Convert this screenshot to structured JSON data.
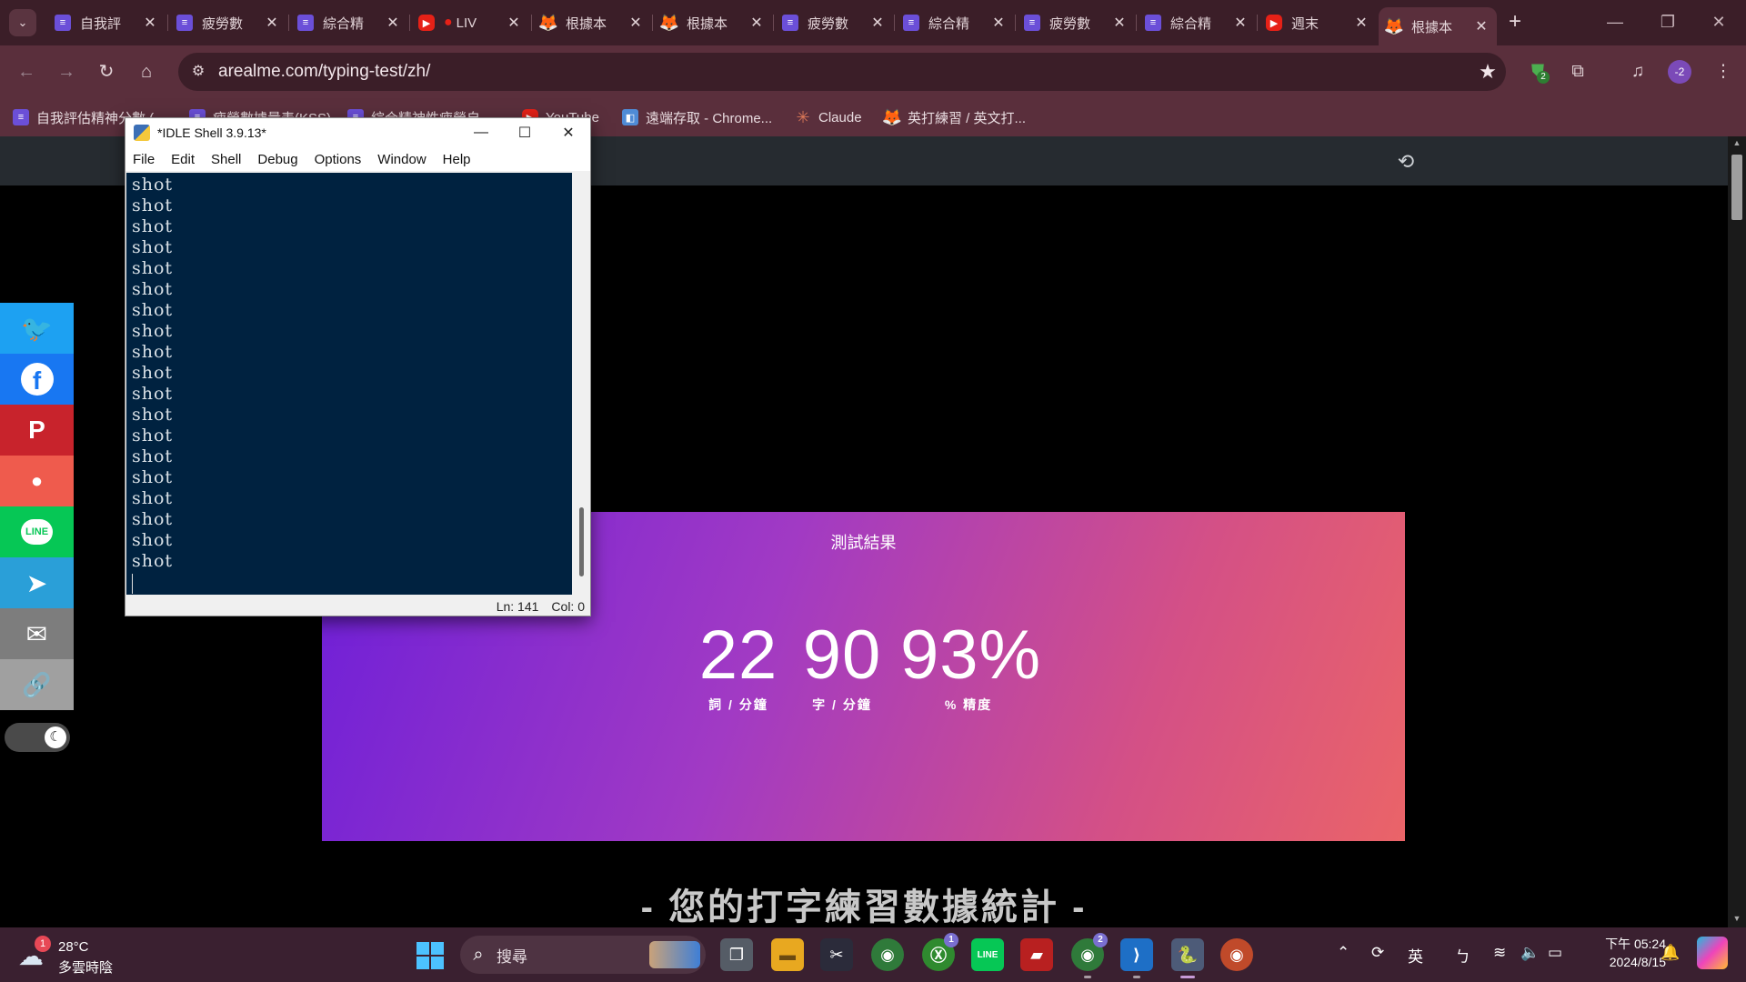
{
  "browser": {
    "tabs": [
      {
        "title": "自我評",
        "icon": "list-icon",
        "color": "#6b4fd8"
      },
      {
        "title": "疲勞數",
        "icon": "list-icon",
        "color": "#6b4fd8"
      },
      {
        "title": "綜合精",
        "icon": "list-icon",
        "color": "#6b4fd8"
      },
      {
        "title": "LIV",
        "icon": "youtube-icon",
        "color": "#e62117"
      },
      {
        "title": "根據本",
        "icon": "fox-icon",
        "color": "#f08a24"
      },
      {
        "title": "根據本",
        "icon": "fox-icon",
        "color": "#f08a24"
      },
      {
        "title": "疲勞數",
        "icon": "list-icon",
        "color": "#6b4fd8"
      },
      {
        "title": "綜合精",
        "icon": "list-icon",
        "color": "#6b4fd8"
      },
      {
        "title": "疲勞數",
        "icon": "list-icon",
        "color": "#6b4fd8"
      },
      {
        "title": "綜合精",
        "icon": "list-icon",
        "color": "#6b4fd8"
      },
      {
        "title": "週末",
        "icon": "youtube-icon",
        "color": "#e62117"
      },
      {
        "title": "根據本",
        "icon": "fox-icon",
        "color": "#f08a24"
      }
    ],
    "active_tab_index": 11,
    "url": "arealme.com/typing-test/zh/",
    "profile_badge": "-2",
    "extension_badge": "2",
    "bookmarks": [
      {
        "label": "自我評估精神分數 (",
        "icon": "list-icon"
      },
      {
        "label": "疲勞數據量表(KSS)",
        "icon": "list-icon"
      },
      {
        "label": "綜合精神性疲勞自...",
        "icon": "list-icon"
      },
      {
        "label": "YouTube",
        "icon": "youtube-icon"
      },
      {
        "label": "遠端存取 - Chrome...",
        "icon": "remote-desktop-icon"
      },
      {
        "label": "Claude",
        "icon": "claude-icon"
      },
      {
        "label": "英打練習 / 英文打...",
        "icon": "fox-icon"
      }
    ]
  },
  "page": {
    "share_buttons": [
      {
        "name": "twitter",
        "glyph": "🐦",
        "color": "#1da1f2"
      },
      {
        "name": "facebook",
        "glyph": "f",
        "color": "#1877f2"
      },
      {
        "name": "pinterest",
        "glyph": "P",
        "color": "#c8232c"
      },
      {
        "name": "weibo",
        "glyph": "微",
        "color": "#ef5b4d"
      },
      {
        "name": "line",
        "glyph": "LINE",
        "color": "#06c755"
      },
      {
        "name": "telegram",
        "glyph": "➤",
        "color": "#2a9fd8"
      },
      {
        "name": "email",
        "glyph": "✉",
        "color": "#7d7d7d"
      },
      {
        "name": "link",
        "glyph": "🔗",
        "color": "#a0a0a0"
      }
    ],
    "result": {
      "title": "測試結果",
      "wpm": "22",
      "wpm_label": "詞 / 分鐘",
      "cpm": "90",
      "cpm_label": "字 / 分鐘",
      "accuracy": "93%",
      "accuracy_label": "% 精度"
    },
    "stats_heading": "- 您的打字練習數據統計 -"
  },
  "idle": {
    "title": "*IDLE Shell 3.9.13*",
    "menu": [
      "File",
      "Edit",
      "Shell",
      "Debug",
      "Options",
      "Window",
      "Help"
    ],
    "output_lines": [
      "shot",
      "shot",
      "shot",
      "shot",
      "shot",
      "shot",
      "shot",
      "shot",
      "shot",
      "shot",
      "shot",
      "shot",
      "shot",
      "shot",
      "shot",
      "shot",
      "shot",
      "shot",
      "shot"
    ],
    "status_ln": "Ln: 141",
    "status_col": "Col: 0"
  },
  "taskbar": {
    "weather_temp": "28°C",
    "weather_desc": "多雲時陰",
    "weather_badge": "1",
    "search_placeholder": "搜尋",
    "ime_label": "英",
    "ime_mode": "ㄅ",
    "time": "下午 05:24",
    "date": "2024/8/15",
    "chrome_badge": "2",
    "xbox_badge": "1"
  }
}
